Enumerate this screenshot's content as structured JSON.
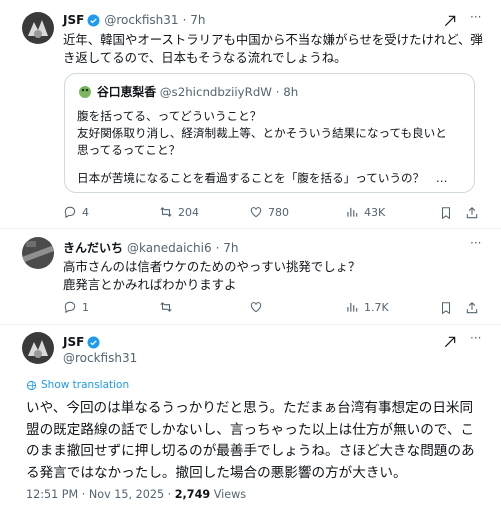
{
  "tweet1": {
    "name": "JSF",
    "handle": "@rockfish31",
    "time": "· 7h",
    "line1": "近年、韓国やオーストラリアも中国から不当な嫌がらせを受けたけれど、弾",
    "line2": "き返してるので、日本もそうなる流れでしょうね。",
    "quote": {
      "name": "谷口恵梨香",
      "handle": "@s2hicndbziiyRdW",
      "time": "· 8h",
      "line1": "腹を括ってる、ってどういうこと？",
      "line2": "友好関係取り消し、経済制裁上等、とかそういう結果になっても良いと",
      "line3": "思ってるってこと？",
      "line4": "日本が苦境になることを看過することを「腹を括る」っていうの？　…"
    },
    "replies": "4",
    "reposts": "204",
    "likes": "780",
    "views": "43K"
  },
  "tweet2": {
    "name": "きんだいち",
    "handle": "@kanedaichi6",
    "time": "· 7h",
    "line1": "高市さんのは信者ウケのためのやっすい挑発でしょ？",
    "line2": "鹿発言とかみればわかりますよ",
    "replies": "1",
    "views": "1.7K"
  },
  "main": {
    "name": "JSF",
    "handle": "@rockfish31",
    "translate": "Show translation",
    "line1": "いや、今回のは単なるうっかりだと思う。ただまぁ台湾有事想定の日米同",
    "line2": "盟の既定路線の話でしかないし、言っちゃった以上は仕方が無いので、こ",
    "line3": "のまま撤回せずに押し切るのが最善手でしょうね。さほど大きな問題のあ",
    "line4": "る発言ではなかったし。撤回した場合の悪影響の方が大きい。",
    "time": "12:51 PM · Nov 15, 2025 · ",
    "views_count": "2,749",
    "views_label": " Views"
  },
  "colors": {
    "verified": "#1d9bf0",
    "muted": "#536471",
    "text": "#0f1419"
  },
  "icons": [
    "reply-icon",
    "repost-icon",
    "like-icon",
    "views-icon",
    "bookmark-icon",
    "share-icon",
    "grok-icon",
    "more-icon",
    "verified-icon",
    "translate-icon"
  ]
}
